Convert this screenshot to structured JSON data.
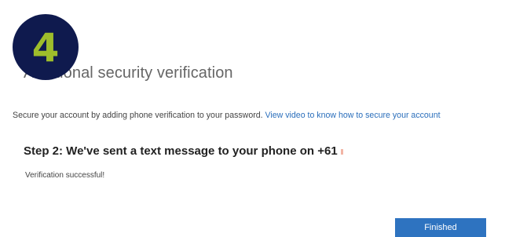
{
  "header": {
    "step_number": "4",
    "title": "Additional security verification"
  },
  "intro": {
    "text": "Secure your account by adding phone verification to your password.",
    "link_text": "View video to know how to secure your account"
  },
  "step": {
    "heading": "Step 2: We've sent a text message to your phone on +61"
  },
  "status": {
    "message": "Verification successful!"
  },
  "actions": {
    "finished_label": "Finished"
  },
  "colors": {
    "badge_background": "#0f1a4e",
    "badge_number": "#9ebd2b",
    "link": "#2a6ebb",
    "button_background": "#2e73c0"
  }
}
